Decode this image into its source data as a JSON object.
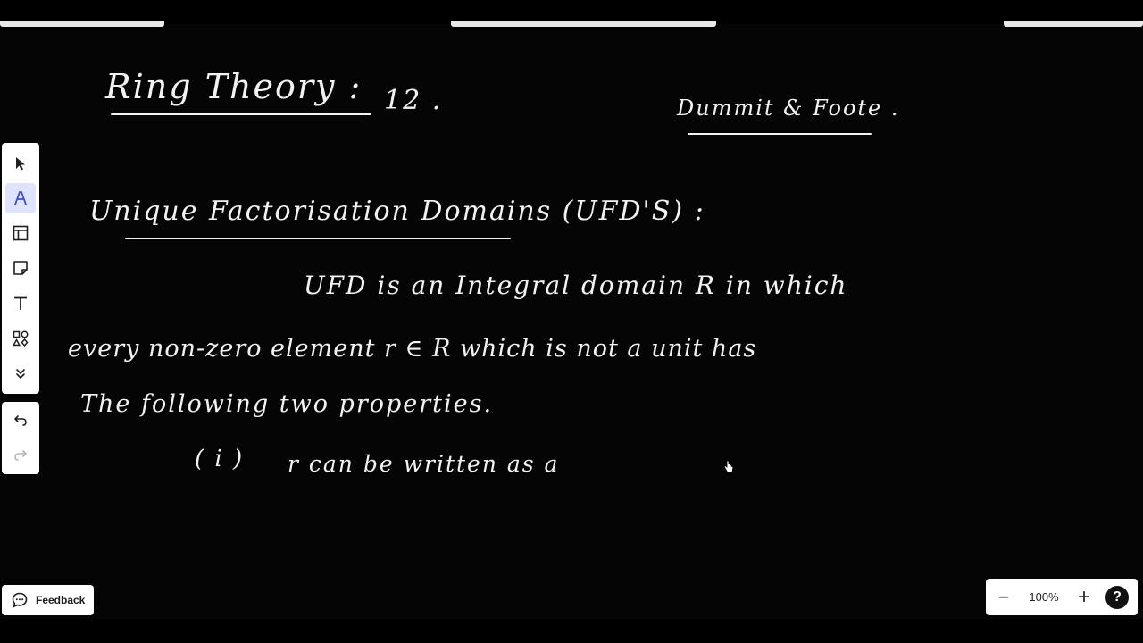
{
  "notes": {
    "title": "Ring Theory :",
    "lecture_number": "12 .",
    "reference": "Dummit & Foote .",
    "heading": "Unique Factorisation Domains (UFD'S) :",
    "line1": "UFD is an Integral domain R in which",
    "line2": "every non-zero element r ∈ R which is not a unit has",
    "line3": "The following two properties.",
    "line4_num": "( i )",
    "line4": "r can be written as a"
  },
  "toolbar": {
    "tools": [
      "pointer-icon",
      "pen-icon",
      "template-icon",
      "sticky-note-icon",
      "text-icon",
      "shapes-icon",
      "more-icon"
    ],
    "active_tool": "pen-icon"
  },
  "history": {
    "tools": [
      "undo-icon",
      "redo-icon"
    ]
  },
  "feedback": {
    "label": "Feedback"
  },
  "zoom": {
    "minus": "−",
    "level": "100%",
    "plus": "+",
    "help": "?"
  },
  "colors": {
    "background": "#000000",
    "ink": "#f2f2f2",
    "panel": "#ffffff",
    "active": "#dfe3ff"
  }
}
